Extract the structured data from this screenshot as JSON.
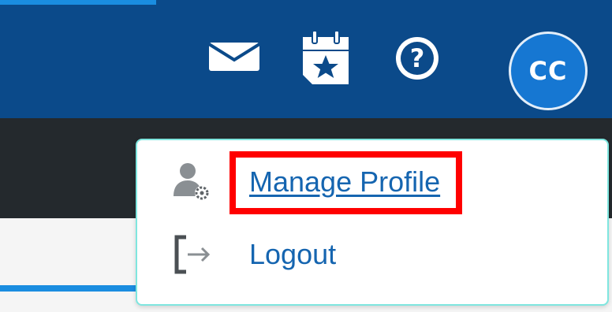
{
  "header": {
    "icons": {
      "mail": "envelope-icon",
      "calendar": "calendar-star-icon",
      "help": "help-question-icon"
    },
    "avatar_initials": "CC",
    "colors": {
      "bar": "#0b4a8a",
      "avatar": "#1677d2",
      "accent": "#1a8de0"
    }
  },
  "menu": {
    "items": [
      {
        "label": "Manage Profile",
        "icon": "user-gear-icon"
      },
      {
        "label": "Logout",
        "icon": "logout-arrow-icon"
      }
    ],
    "highlight_color": "#ff0000",
    "border_color": "#7fe6df",
    "link_color": "#1565b0"
  }
}
